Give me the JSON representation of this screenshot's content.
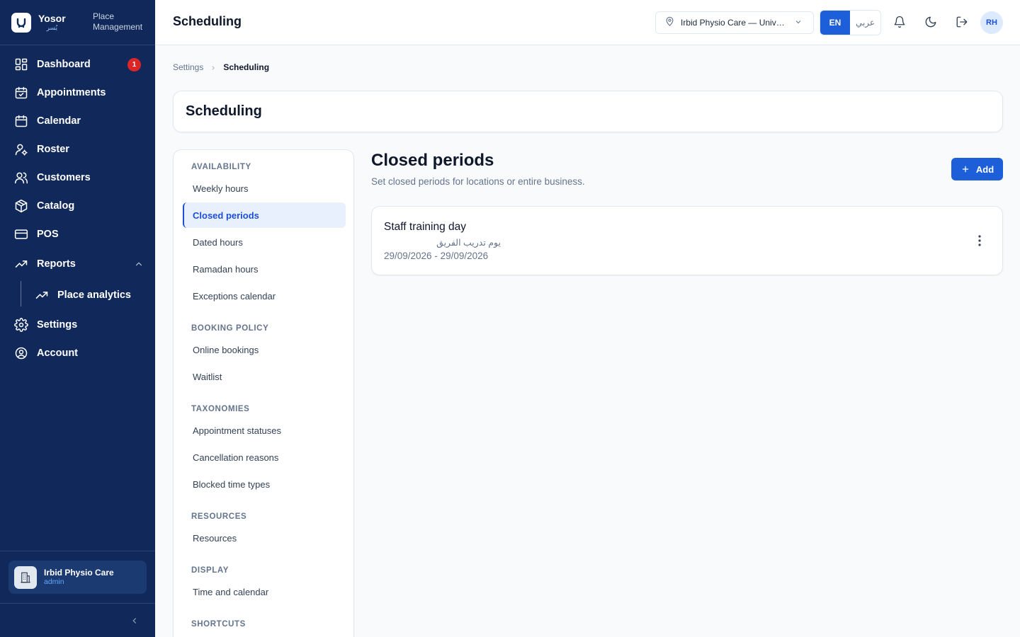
{
  "brand": {
    "name": "Yosor",
    "name_ar": "يُسر",
    "subtitle": "Place Management"
  },
  "sidebar": {
    "items": [
      {
        "label": "Dashboard",
        "icon": "dashboard-icon",
        "badge": "1"
      },
      {
        "label": "Appointments",
        "icon": "calendar-check-icon"
      },
      {
        "label": "Calendar",
        "icon": "calendar-icon"
      },
      {
        "label": "Roster",
        "icon": "user-gear-icon"
      },
      {
        "label": "Customers",
        "icon": "users-icon"
      },
      {
        "label": "Catalog",
        "icon": "package-icon"
      },
      {
        "label": "POS",
        "icon": "card-icon"
      },
      {
        "label": "Reports",
        "icon": "trending-up-icon",
        "expanded": true
      },
      {
        "label": "Settings",
        "icon": "gear-icon"
      },
      {
        "label": "Account",
        "icon": "user-circle-icon"
      }
    ],
    "reports_sub": {
      "label": "Place analytics",
      "icon": "trending-up-icon"
    },
    "place": {
      "name": "Irbid Physio Care",
      "role": "admin"
    }
  },
  "header": {
    "title": "Scheduling",
    "location": "Irbid Physio Care — University Street",
    "lang_en": "EN",
    "lang_ar": "عربي",
    "avatar": "RH"
  },
  "breadcrumb": {
    "parent": "Settings",
    "current": "Scheduling"
  },
  "page": {
    "title": "Scheduling"
  },
  "subnav": {
    "sections": [
      {
        "title": "AVAILABILITY",
        "items": [
          "Weekly hours",
          "Closed periods",
          "Dated hours",
          "Ramadan hours",
          "Exceptions calendar"
        ]
      },
      {
        "title": "BOOKING POLICY",
        "items": [
          "Online bookings",
          "Waitlist"
        ]
      },
      {
        "title": "TAXONOMIES",
        "items": [
          "Appointment statuses",
          "Cancellation reasons",
          "Blocked time types"
        ]
      },
      {
        "title": "RESOURCES",
        "items": [
          "Resources"
        ]
      },
      {
        "title": "DISPLAY",
        "items": [
          "Time and calendar"
        ]
      },
      {
        "title": "SHORTCUTS",
        "items": []
      }
    ],
    "active": "Closed periods"
  },
  "content": {
    "title": "Closed periods",
    "subtitle": "Set closed periods for locations or entire business.",
    "add_label": "Add",
    "periods": [
      {
        "name": "Staff training day",
        "name_ar": "يوم تدريب الفريق",
        "dates": "29/09/2026 - 29/09/2026"
      }
    ]
  },
  "colors": {
    "sidebar": "#11295a",
    "accent": "#1d5fd8",
    "badge": "#dc2626"
  }
}
